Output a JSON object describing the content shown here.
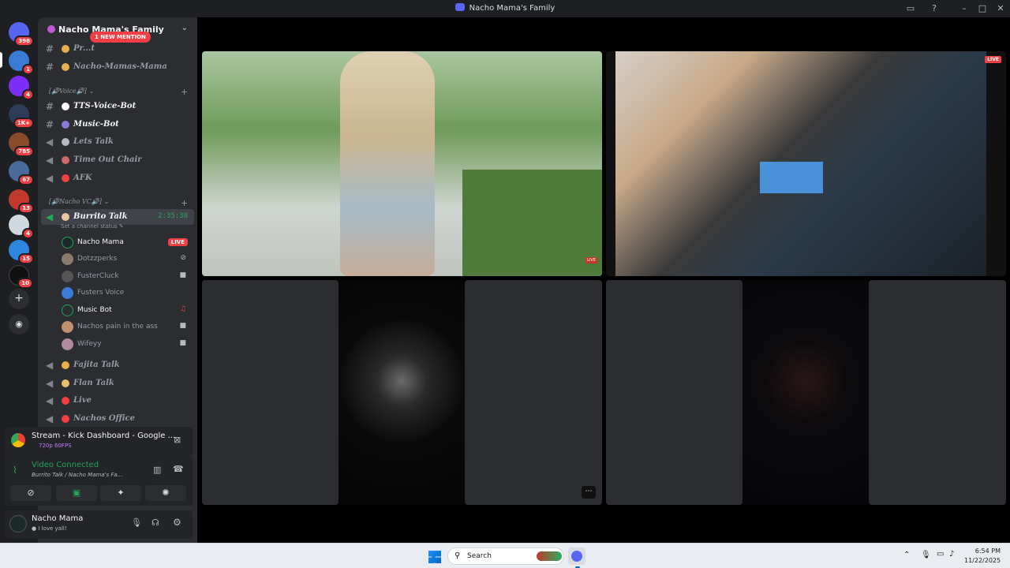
{
  "window": {
    "title": "Nacho Mama's Family"
  },
  "servers": [
    {
      "name": "discord-home",
      "badge": "398",
      "color": "#5865f2"
    },
    {
      "name": "server-1",
      "badge": "1",
      "color": "#3a7bd5"
    },
    {
      "name": "server-2",
      "badge": "4",
      "color": "#7b2ff7"
    },
    {
      "name": "server-3",
      "badge": "1K+",
      "color": "#2d3b55"
    },
    {
      "name": "server-4",
      "badge": "785",
      "color": "#8a4b2a"
    },
    {
      "name": "server-5",
      "badge": "67",
      "color": "#4a6a9a"
    },
    {
      "name": "server-6",
      "badge": "13",
      "color": "#c0392b"
    },
    {
      "name": "server-7",
      "badge": "4",
      "color": "#d0d8e0"
    },
    {
      "name": "server-8",
      "badge": "15",
      "color": "#2e86de"
    },
    {
      "name": "server-9",
      "badge": "10",
      "color": "#111111"
    }
  ],
  "guild": {
    "name": "Nacho Mama's Family",
    "mention": "1 NEW MENTION"
  },
  "channels_top": [
    {
      "name": "Pr...t",
      "icon": "#"
    },
    {
      "name": "Nacho-Mamas-Mama",
      "icon": "#"
    }
  ],
  "category_voice": "[🔊Voice🔊]",
  "voice_channels": [
    {
      "name": "TTS-Voice-Bot",
      "icon": "#"
    },
    {
      "name": "Music-Bot",
      "icon": "#"
    },
    {
      "name": "Lets Talk",
      "icon": "🔊"
    },
    {
      "name": "Time Out Chair",
      "icon": "🔊"
    },
    {
      "name": "AFK",
      "icon": "🔊"
    }
  ],
  "category_vc": "[🔊Nacho VC🔊]",
  "active_channel": {
    "name": "Burrito Talk",
    "timer": "2:35:30",
    "status": "Set a channel status"
  },
  "members": [
    {
      "name": "Nacho Mama",
      "live": "LIVE",
      "bright": true,
      "color": "#1a2a2a"
    },
    {
      "name": "Dotzzperks",
      "icon": "mute-icon",
      "color": "#8a7b6a"
    },
    {
      "name": "FusterCluck",
      "icon": "video-icon",
      "color": "#555555"
    },
    {
      "name": "Fusters Voice",
      "color": "#3a7bd5"
    },
    {
      "name": "Music Bot",
      "icon": "headphones-icon",
      "bright": true,
      "color": "#2b2d31"
    },
    {
      "name": "Nachos pain in the ass",
      "icon": "video-icon",
      "color": "#c09070"
    },
    {
      "name": "Wifeyy",
      "icon": "video-icon",
      "color": "#b08aa0"
    }
  ],
  "channels_bottom": [
    {
      "name": "Fajita Talk"
    },
    {
      "name": "Flan Talk"
    },
    {
      "name": "Live"
    },
    {
      "name": "Nachos Office"
    }
  ],
  "stream_panel": {
    "title": "Stream - Kick Dashboard - Google ...",
    "quality": "720p 60FPS"
  },
  "voice_panel": {
    "status": "Video Connected",
    "channel": "Burrito Talk / Nacho Mama's Fa..."
  },
  "user_panel": {
    "name": "Nacho Mama",
    "status": "I love yall!"
  },
  "taskbar": {
    "search": "Search",
    "time": "6:54 PM",
    "date": "11/22/2025"
  },
  "stream_label": "LIVE"
}
